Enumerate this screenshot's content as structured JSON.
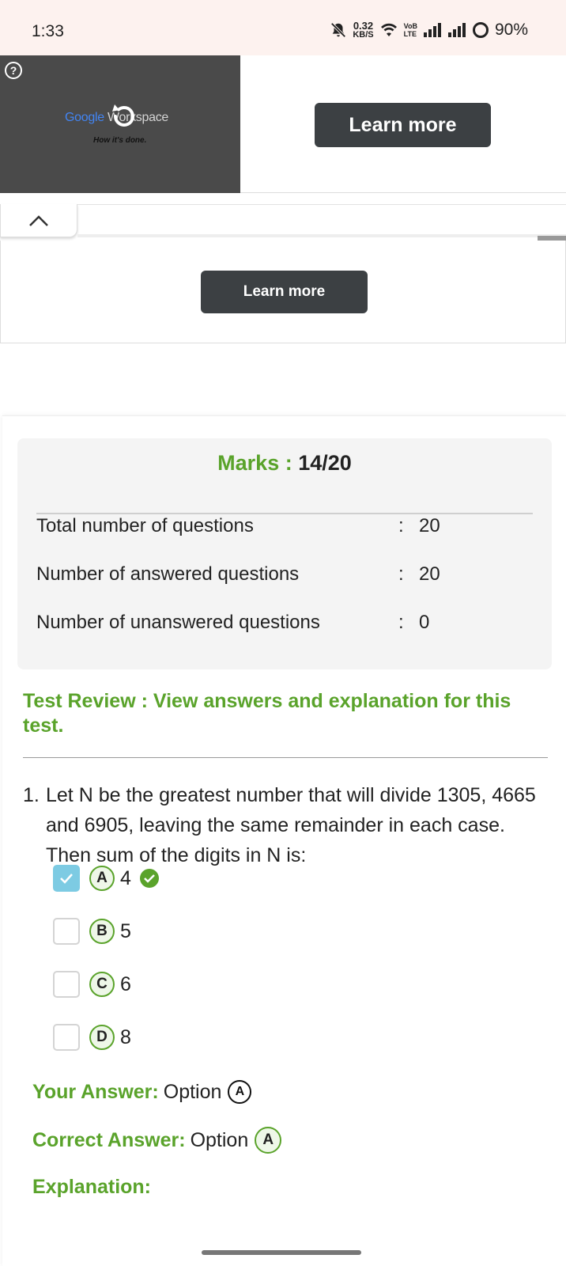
{
  "status_bar": {
    "time": "1:33",
    "net_speed_value": "0.32",
    "net_speed_unit": "KB/S",
    "volte_top": "VoB",
    "volte_bottom": "LTE",
    "battery": "90%"
  },
  "ad": {
    "brand_google": "Google",
    "brand_workspace": "Workspace",
    "tagline": "How it's done.",
    "learn_more_top": "Learn more",
    "learn_more_bottom": "Learn more",
    "help_symbol": "?"
  },
  "results": {
    "marks_label": "Marks :",
    "marks_value": "14/20",
    "stats": [
      {
        "label": "Total number of questions",
        "colon": ":",
        "value": "20"
      },
      {
        "label": "Number of answered questions",
        "colon": ":",
        "value": "20"
      },
      {
        "label": "Number of unanswered questions",
        "colon": ":",
        "value": "0"
      }
    ],
    "review_text": "Test Review : View answers and explanation for this test."
  },
  "question": {
    "number": "1.",
    "text": "Let N be the greatest number that will divide 1305, 4665 and 6905, leaving the same remainder in each case. Then sum of the digits in N is:",
    "options": [
      {
        "letter": "A",
        "text": "4",
        "checked": true,
        "correct": true
      },
      {
        "letter": "B",
        "text": "5",
        "checked": false,
        "correct": false
      },
      {
        "letter": "C",
        "text": "6",
        "checked": false,
        "correct": false
      },
      {
        "letter": "D",
        "text": "8",
        "checked": false,
        "correct": false
      }
    ],
    "your_answer_label": "Your Answer:",
    "your_answer_text": "Option",
    "your_answer_letter": "A",
    "correct_answer_label": "Correct Answer:",
    "correct_answer_text": "Option",
    "correct_answer_letter": "A",
    "explanation_label": "Explanation:"
  },
  "colors": {
    "accent_green": "#5aa32b",
    "checkbox_blue": "#7dcbe3",
    "button_dark": "#3c4043",
    "status_bg": "#fdf2ef"
  }
}
